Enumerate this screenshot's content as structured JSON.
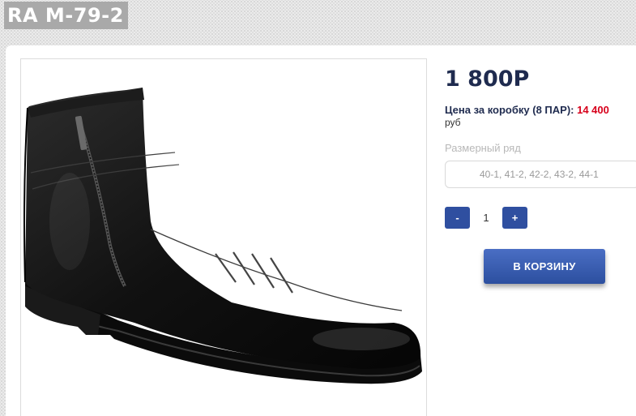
{
  "product": {
    "title": "RA M-79-2",
    "image_alt": "black leather ankle boot with side zipper"
  },
  "pricing": {
    "price": "1 800Р",
    "box_label": "Цена за коробку (8 ПАР):",
    "box_value": "14 400",
    "box_unit": "руб"
  },
  "sizes": {
    "label": "Размерный ряд",
    "selected": "40-1, 41-2, 42-2, 43-2, 44-1"
  },
  "quantity": {
    "minus_label": "-",
    "value": "1",
    "plus_label": "+"
  },
  "cart": {
    "button_label": "В КОРЗИНУ"
  },
  "colors": {
    "accent": "#2f4fa0",
    "price_text": "#1f2b4f",
    "box_value": "#d7001b",
    "title_bg": "#a9a9a9"
  }
}
